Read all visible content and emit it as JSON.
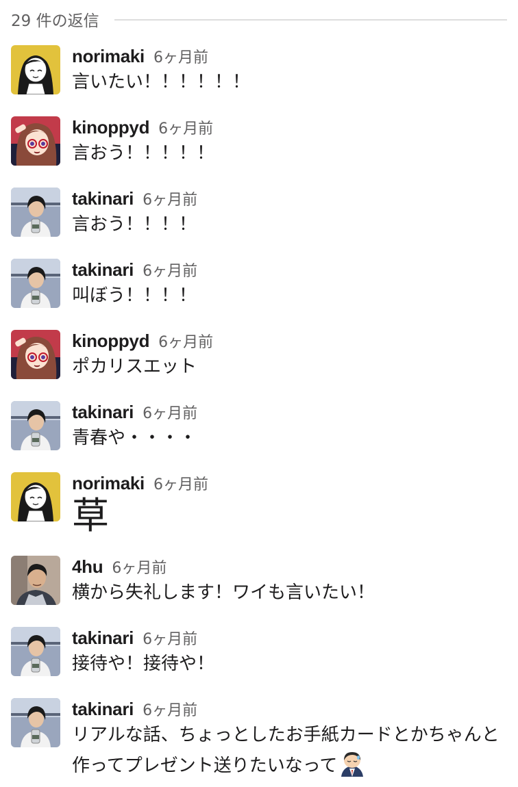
{
  "thread": {
    "reply_count": "29 件の返信"
  },
  "messages": [
    {
      "author": "norimaki",
      "time": "6ヶ月前",
      "text": "言いたい！！！！！！",
      "avatar": "norimaki-avatar"
    },
    {
      "author": "kinoppyd",
      "time": "6ヶ月前",
      "text": "言おう！！！！！",
      "avatar": "kinoppyd-avatar"
    },
    {
      "author": "takinari",
      "time": "6ヶ月前",
      "text": "言おう！！！！",
      "avatar": "takinari-avatar"
    },
    {
      "author": "takinari",
      "time": "6ヶ月前",
      "text": "叫ぼう！！！！",
      "avatar": "takinari-avatar"
    },
    {
      "author": "kinoppyd",
      "time": "6ヶ月前",
      "text": "ポカリスエット",
      "avatar": "kinoppyd-avatar"
    },
    {
      "author": "takinari",
      "time": "6ヶ月前",
      "text": "青春や・・・・",
      "avatar": "takinari-avatar"
    },
    {
      "author": "norimaki",
      "time": "6ヶ月前",
      "text": "草",
      "avatar": "norimaki-avatar"
    },
    {
      "author": "4hu",
      "time": "6ヶ月前",
      "text": "横から失礼します！ワイも言いたい！",
      "avatar": "4hu-avatar"
    },
    {
      "author": "takinari",
      "time": "6ヶ月前",
      "text": "接待や！接待や！",
      "avatar": "takinari-avatar"
    },
    {
      "author": "takinari",
      "time": "6ヶ月前",
      "text": "リアルな話、ちょっとしたお手紙カードとかちゃんと作ってプレゼント送りたいなって",
      "avatar": "takinari-avatar",
      "emoji": "bowing-man-emoji"
    }
  ]
}
